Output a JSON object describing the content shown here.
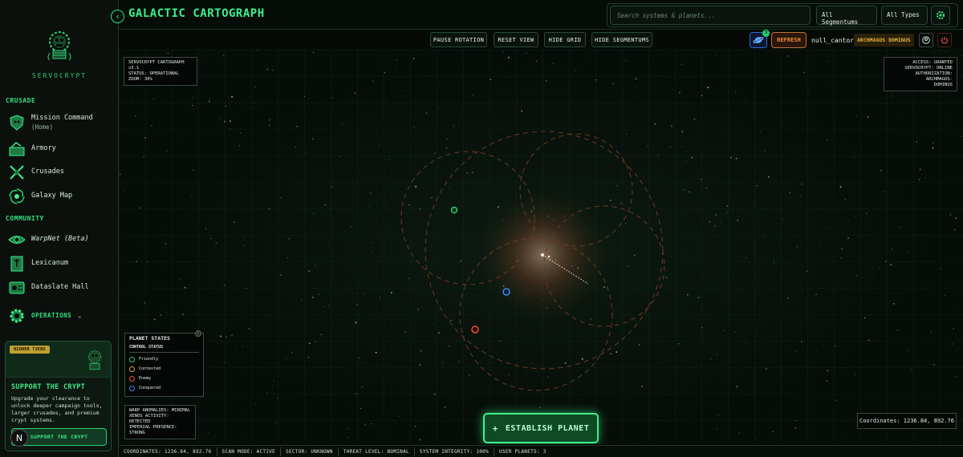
{
  "app": {
    "title": "GALACTIC CARTOGRAPH"
  },
  "sidebar": {
    "logo_text": "SERVOCRYPT",
    "sections": {
      "crusade": "CRUSADE",
      "community": "COMMUNITY"
    },
    "items": [
      {
        "label": "Mission Command",
        "sub": "(Home)",
        "icon": "skull-shield-icon"
      },
      {
        "label": "Armory",
        "icon": "armory-icon"
      },
      {
        "label": "Crusades",
        "icon": "crossed-swords-icon"
      },
      {
        "label": "Galaxy Map",
        "icon": "galaxy-icon"
      },
      {
        "label": "WarpNet (Beta)",
        "icon": "eye-icon"
      },
      {
        "label": "Lexicanum",
        "icon": "book-icon"
      },
      {
        "label": "Dataslate Hall",
        "icon": "dataslate-icon"
      }
    ],
    "operations_label": "OPERATIONS",
    "support": {
      "badge": "HIGHER TIERS",
      "title": "SUPPORT THE CRYPT",
      "body": "Upgrade your clearance to unlock deeper campaign tools, larger crusades, and premium crypt systems.",
      "button": "SUPPORT THE CRYPT"
    },
    "n_badge": "N"
  },
  "header": {
    "search_placeholder": "Search systems & planets...",
    "segmentum_filter": "All Segmentums",
    "type_filter": "All Types"
  },
  "toolbar": {
    "pause_rotation": "PAUSE ROTATION",
    "reset_view": "RESET VIEW",
    "hide_grid": "HIDE GRID",
    "hide_segmentums": "HIDE SEGMENTUMS",
    "planet_count": "3",
    "refresh": "REFRESH",
    "username": "null_cantor",
    "rank": "ARCHMAGOS DOMINUS"
  },
  "map": {
    "info_panel": {
      "line1": "SERVOCRYPT CARTOGRAPH v3.1",
      "line2": "STATUS: OPERATIONAL",
      "line3": "ZOOM: 30%"
    },
    "access_panel": {
      "line1": "ACCESS: GRANTED",
      "line2": "SERVOCRYPT: ONLINE",
      "line3": "AUTHORIZATION: ARCHMAGOS-",
      "line4": "DOMINUS"
    },
    "legend": {
      "title": "PLANET STATES",
      "subtitle": "CONTROL STATUS",
      "entries": [
        {
          "label": "Friendly",
          "color": "#2bcf72"
        },
        {
          "label": "Contested",
          "color": "#e8a23a"
        },
        {
          "label": "Enemy",
          "color": "#e8503a"
        },
        {
          "label": "Conquered",
          "color": "#3a8ae8"
        }
      ]
    },
    "warp_panel": {
      "line1": "WARP ANOMALIES: MINIMAL",
      "line2": "XENOS ACTIVITY: DETECTED",
      "line3": "IMPERIAL PRESENCE: STRONG"
    },
    "coordinates": "Coordinates: 1236.84, 892.76",
    "establish_button": "ESTABLISH PLANET"
  },
  "statusbar": {
    "coordinates": "COORDINATES: 1236.84, 892.76",
    "scan_mode": "SCAN MODE: ACTIVE",
    "sector": "SECTOR: UNKNOWN",
    "threat": "THREAT LEVEL: NOMINAL",
    "integrity": "SYSTEM INTEGRITY: 100%",
    "user_planets": "USER PLANETS: 3"
  },
  "colors": {
    "accent": "#3df08a",
    "friendly": "#2bcf72",
    "contested": "#e8a23a",
    "enemy": "#e8503a",
    "conquered": "#3a8ae8",
    "refresh": "#f08a3a"
  }
}
